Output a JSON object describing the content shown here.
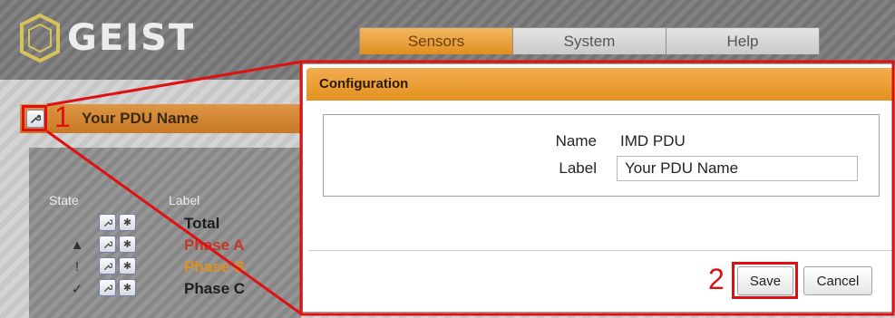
{
  "app": {
    "logo_text": "GEIST"
  },
  "tabs": [
    {
      "label": "Sensors",
      "active": true
    },
    {
      "label": "System",
      "active": false
    },
    {
      "label": "Help",
      "active": false
    }
  ],
  "pdu": {
    "name": "Your PDU Name",
    "config_icon": "wrench-icon"
  },
  "annotations": {
    "step1": "1",
    "step2": "2",
    "color": "#e01010"
  },
  "sensor_table": {
    "col_state": "State",
    "col_label": "Label",
    "rows": [
      {
        "state_icon": "",
        "label": "Total",
        "color": "#1e1e1e"
      },
      {
        "state_icon": "▲",
        "label": "Phase A",
        "color": "#c0392b"
      },
      {
        "state_icon": "!",
        "label": "Phase B",
        "color": "#e08f1f"
      },
      {
        "state_icon": "✓",
        "label": "Phase C",
        "color": "#1e1e1e"
      }
    ]
  },
  "dialog": {
    "title": "Configuration",
    "name_label": "Name",
    "name_value": "IMD PDU",
    "label_label": "Label",
    "label_value": "Your PDU Name",
    "save_label": "Save",
    "cancel_label": "Cancel"
  },
  "colors": {
    "accent_orange": "#e3911f",
    "header_gray": "#7a7a7a"
  }
}
